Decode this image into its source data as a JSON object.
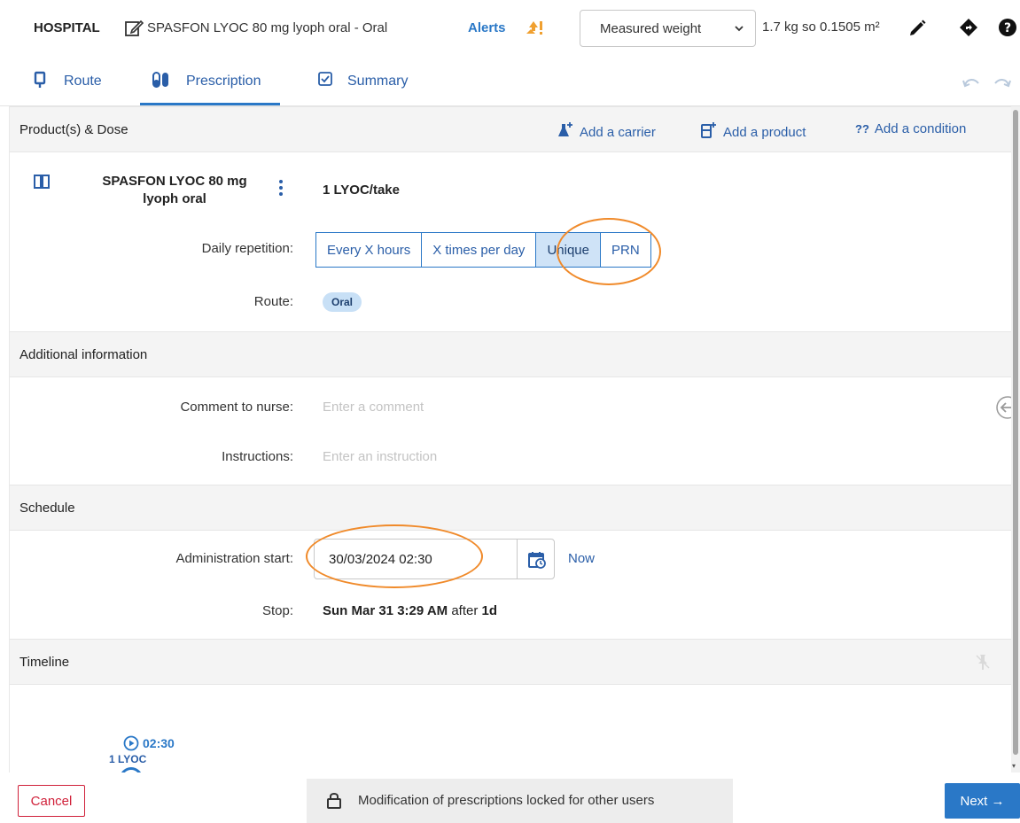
{
  "header": {
    "hospital": "HOSPITAL",
    "drug_title": "SPASFON LYOC 80 mg lyoph oral - Oral",
    "alerts_label": "Alerts",
    "weight_select": "Measured weight",
    "weight_value": "1.7 kg so 0.1505 m²"
  },
  "tabs": [
    {
      "label": "Route",
      "icon": "route-icon"
    },
    {
      "label": "Prescription",
      "icon": "pills-icon",
      "active": true
    },
    {
      "label": "Summary",
      "icon": "summary-icon"
    }
  ],
  "products": {
    "title": "Product(s) & Dose",
    "actions": {
      "add_carrier": "Add a carrier",
      "add_product": "Add a product",
      "add_condition": "Add a condition"
    },
    "product_name": "SPASFON LYOC 80 mg lyoph oral",
    "dose": "1 LYOC/take",
    "daily_repetition_label": "Daily repetition:",
    "repetition_options": [
      "Every X hours",
      "X times per day",
      "Unique",
      "PRN"
    ],
    "repetition_selected": "Unique",
    "route_label": "Route:",
    "route_value": "Oral"
  },
  "additional": {
    "title": "Additional information",
    "comment_label": "Comment to nurse:",
    "comment_placeholder": "Enter a comment",
    "instructions_label": "Instructions:",
    "instructions_placeholder": "Enter an instruction"
  },
  "schedule": {
    "title": "Schedule",
    "admin_start_label": "Administration start:",
    "admin_start_value": "30/03/2024 02:30",
    "now_label": "Now",
    "stop_label": "Stop:",
    "stop_date": "Sun Mar 31 3:29 AM",
    "stop_after": "after",
    "stop_duration": "1d"
  },
  "timeline": {
    "title": "Timeline",
    "time": "02:30",
    "dose": "1 LYOC"
  },
  "footer": {
    "cancel": "Cancel",
    "lock_message": "Modification of prescriptions locked for other users",
    "next": "Next →"
  },
  "colors": {
    "accent": "#2a78c7",
    "link": "#2a5ea8",
    "selected_bg": "#cfe3f7",
    "cancel_red": "#d0213a",
    "annotation_orange": "#f08a2a",
    "alert_orange": "#f0a030"
  }
}
